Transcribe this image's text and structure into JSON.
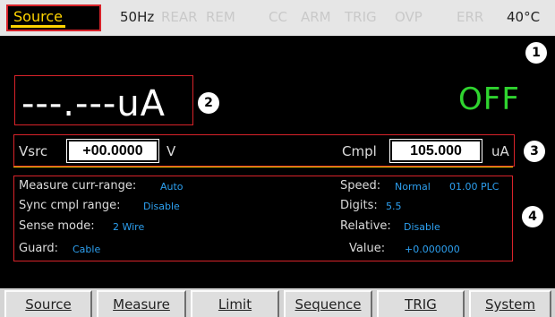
{
  "status_bar": {
    "function": "Source",
    "indicators": [
      {
        "label": "50Hz",
        "active": true
      },
      {
        "label": "REAR",
        "active": false
      },
      {
        "label": "REM",
        "active": false
      },
      {
        "label": "CC",
        "active": false
      },
      {
        "label": "ARM",
        "active": false
      },
      {
        "label": "TRIG",
        "active": false
      },
      {
        "label": "OVP",
        "active": false
      },
      {
        "label": "ERR",
        "active": false
      }
    ],
    "temperature": "40°C"
  },
  "callouts": [
    "1",
    "2",
    "3",
    "4"
  ],
  "reading": {
    "value": "---.---uA",
    "output_state": "OFF"
  },
  "source_row": {
    "vsrc_label": "Vsrc",
    "vsrc_value": "+00.0000",
    "vsrc_unit": "V",
    "cmpl_label": "Cmpl",
    "cmpl_value": "105.000",
    "cmpl_unit": "uA"
  },
  "settings": {
    "measure_range_label": "Measure curr-range:",
    "measure_range_value": "Auto",
    "sync_cmpl_label": "Sync cmpl range:",
    "sync_cmpl_value": "Disable",
    "sense_label": "Sense mode:",
    "sense_value": "2 Wire",
    "guard_label": "Guard:",
    "guard_value": "Cable",
    "speed_label": "Speed:",
    "speed_value": "Normal",
    "speed_plc": "01.00 PLC",
    "digits_label": "Digits:",
    "digits_value": "5.5",
    "relative_label": "Relative:",
    "relative_value": "Disable",
    "value_label": "Value:",
    "value_value": "+0.000000"
  },
  "menu": [
    "Source",
    "Measure",
    "Limit",
    "Sequence",
    "TRIG",
    "System"
  ],
  "colors": {
    "accent_yellow": "#ffd400",
    "output_off_green": "#2fd42f",
    "value_blue": "#2da0f0",
    "callout_red": "#d8232a"
  }
}
